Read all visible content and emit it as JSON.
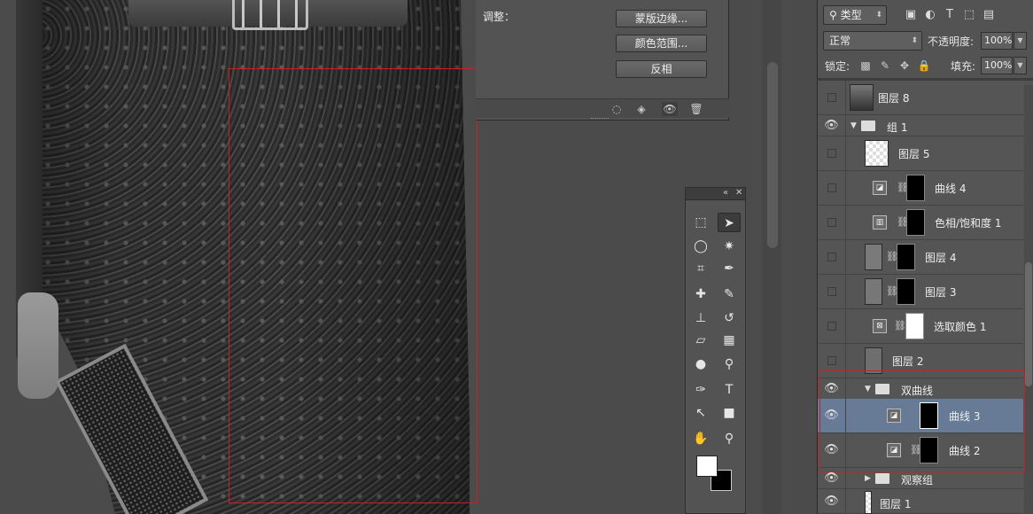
{
  "dialog": {
    "adjust_label": "调整：",
    "buttons": [
      "蒙版边缘...",
      "颜色范围...",
      "反相"
    ]
  },
  "layers_panel": {
    "filter_type": "类型",
    "blend_mode": "正常",
    "opacity_label": "不透明度:",
    "opacity_value": "100%",
    "lock_label": "锁定:",
    "fill_label": "填充:",
    "fill_value": "100%",
    "layers": [
      {
        "name": "图层 8",
        "kind": "image",
        "visible": false
      },
      {
        "name": "组 1",
        "kind": "group",
        "visible": true
      },
      {
        "name": "图层 5",
        "kind": "transparent",
        "visible": false
      },
      {
        "name": "曲线 4",
        "kind": "curves",
        "visible": false
      },
      {
        "name": "色相/饱和度 1",
        "kind": "hue",
        "visible": false
      },
      {
        "name": "图层 4",
        "kind": "masked",
        "visible": false
      },
      {
        "name": "图层 3",
        "kind": "masked",
        "visible": false
      },
      {
        "name": "选取颜色 1",
        "kind": "selective",
        "visible": false
      },
      {
        "name": "图层 2",
        "kind": "plain",
        "visible": false
      },
      {
        "name": "双曲线",
        "kind": "group",
        "visible": true
      },
      {
        "name": "曲线 3",
        "kind": "curves",
        "visible": true,
        "selected": true
      },
      {
        "name": "曲线 2",
        "kind": "curves",
        "visible": true
      },
      {
        "name": "观察组",
        "kind": "group-collapsed",
        "visible": true
      },
      {
        "name": "图层 1",
        "kind": "plain",
        "visible": true
      }
    ]
  },
  "colors": {
    "selection_outline": "#c8202a",
    "selected_layer": "#677a96"
  }
}
